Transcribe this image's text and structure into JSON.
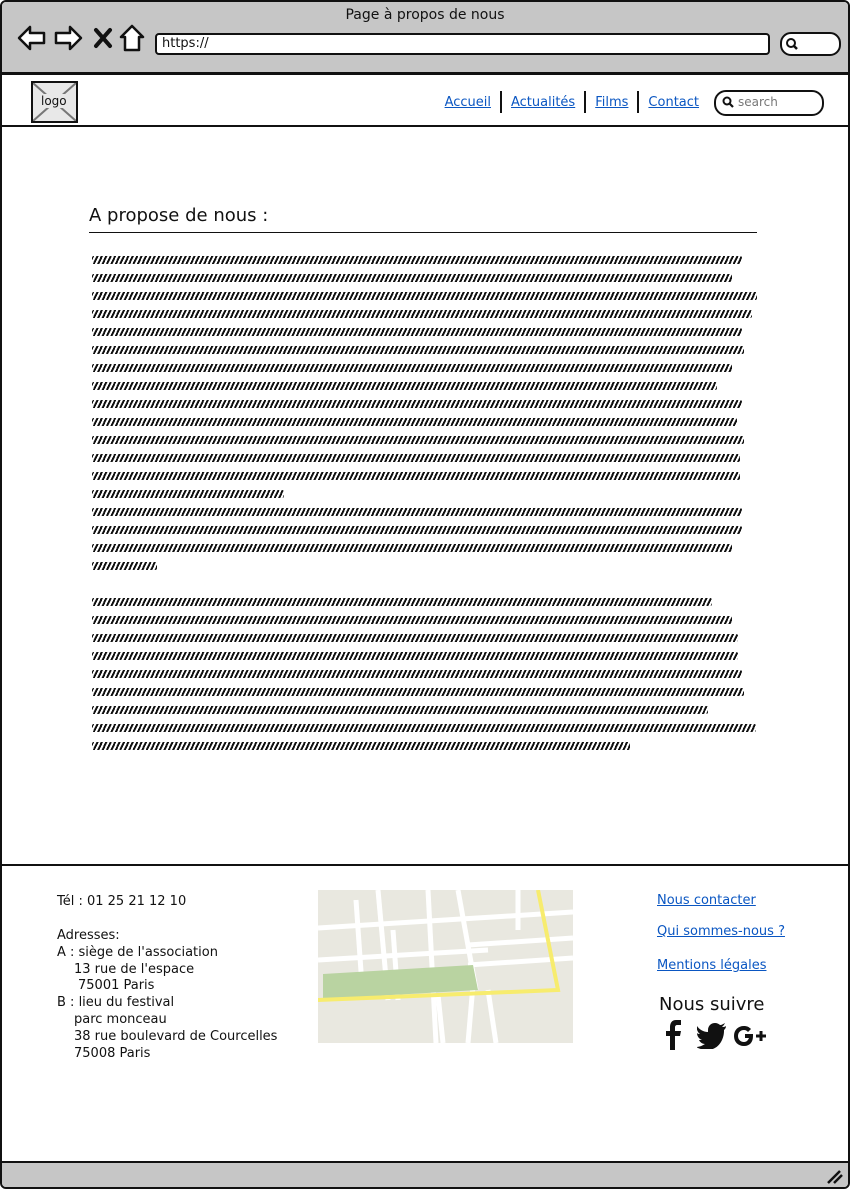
{
  "browser": {
    "title": "Page à propos de nous",
    "url": "https://"
  },
  "header": {
    "logo_label": "logo",
    "nav": [
      "Accueil",
      "Actualités",
      "Films",
      "Contact"
    ],
    "search_placeholder": "search"
  },
  "main": {
    "heading": "A propose de nous :"
  },
  "footer": {
    "phone": "Tél : 01 25 21 12 10",
    "addresses_label": "Adresses:",
    "address_a_title": "A : siège de l'association",
    "address_a_line1": "13 rue de l'espace",
    "address_a_line2": "75001 Paris",
    "address_b_title": "B : lieu du festival",
    "address_b_line1": "parc monceau",
    "address_b_line2": "38 rue boulevard de Courcelles",
    "address_b_line3": "75008 Paris",
    "links": [
      "Nous contacter",
      "Qui sommes-nous ?",
      "Mentions légales"
    ],
    "follow_label": "Nous suivre",
    "social_icons": [
      "facebook-icon",
      "twitter-icon",
      "google-plus-icon"
    ]
  },
  "colors": {
    "chrome_gray": "#c6c6c6",
    "link_blue": "#0a56c2",
    "map_road_yellow": "#f7ec6e",
    "map_park_green": "#b9d3a1"
  }
}
